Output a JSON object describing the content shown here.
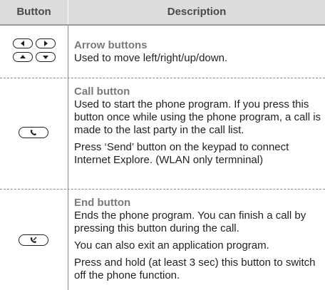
{
  "header": {
    "button_col": "Button",
    "description_col": "Description"
  },
  "rows": [
    {
      "title": "Arrow buttons",
      "paragraphs": [
        "Used to move left/right/up/down."
      ],
      "icon": "arrow-keys-icon"
    },
    {
      "title": "Call button",
      "paragraphs": [
        "Used to start the phone program. If you press this button once while using the phone program, a call is made to the last party in the call list.",
        "Press ‘Send’ button on the keypad to connect Internet Explore. (WLAN only termninal)"
      ],
      "icon": "call-key-icon"
    },
    {
      "title": "End button",
      "paragraphs": [
        "Ends the phone program. You can finish a call by pressing this button during the call.",
        "You can also exit an application program.",
        "Press and hold (at least 3 sec) this button to switch off the phone function."
      ],
      "icon": "end-key-icon"
    }
  ]
}
